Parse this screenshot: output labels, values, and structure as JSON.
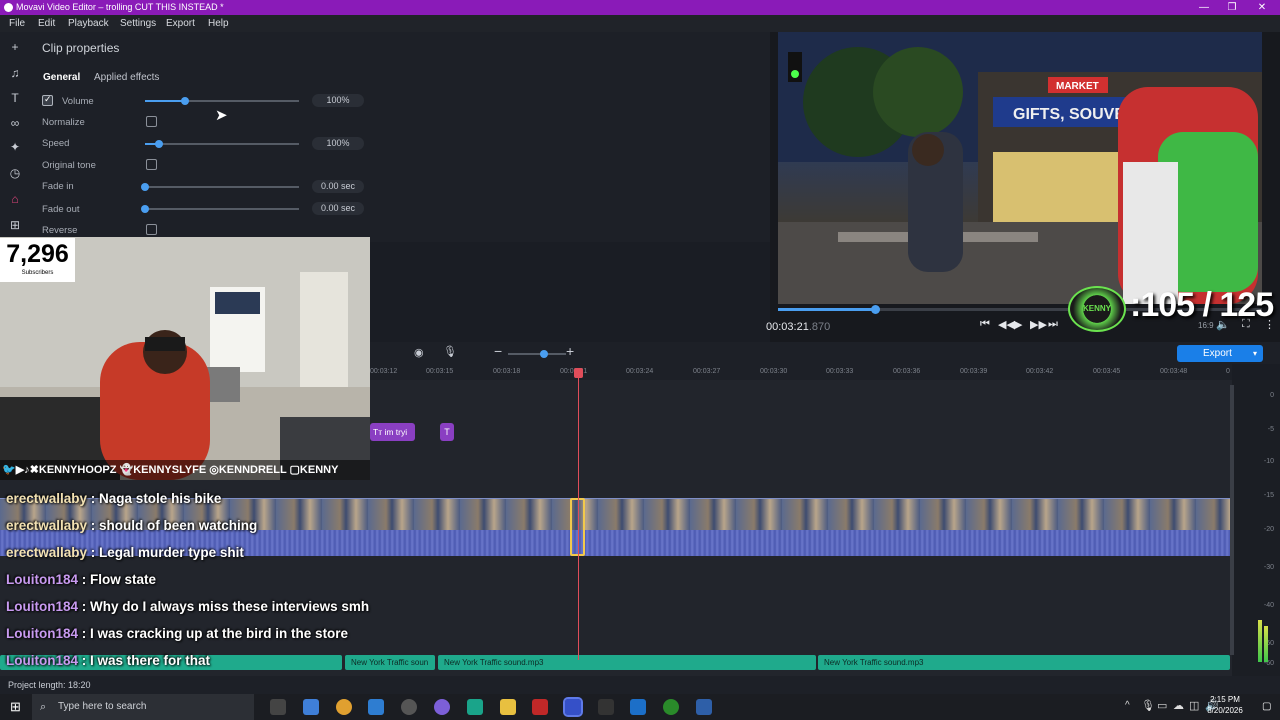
{
  "window": {
    "title": "Movavi Video Editor – trolling CUT THIS INSTEAD *",
    "controls": [
      "—",
      "❐",
      "✕"
    ]
  },
  "menu": [
    "File",
    "Edit",
    "Playback",
    "Settings",
    "Export",
    "Help"
  ],
  "sidebar_icons": [
    "plus-icon",
    "music-icon",
    "text-icon",
    "transitions-icon",
    "magic-icon",
    "clock-icon",
    "stickers-icon",
    "grid-icon"
  ],
  "props": {
    "title": "Clip properties",
    "tabs": [
      "General",
      "Applied effects"
    ],
    "rows": {
      "volume": {
        "label": "Volume",
        "value": "100%",
        "level": 0.26
      },
      "normalize": {
        "label": "Normalize"
      },
      "speed": {
        "label": "Speed",
        "value": "100%",
        "level": 0.09
      },
      "original_tone": {
        "label": "Original tone"
      },
      "fade_in": {
        "label": "Fade in",
        "value": "0.00 sec",
        "level": 0
      },
      "fade_out": {
        "label": "Fade out",
        "value": "0.00 sec",
        "level": 0
      },
      "reverse": {
        "label": "Reverse"
      }
    }
  },
  "player": {
    "timecode_main": "00:03:21",
    "timecode_frac": ".870",
    "aspect": "16:9",
    "progress": 0.2
  },
  "overlay": {
    "subs_count": "7,296",
    "subs_label": "Subscribers",
    "socials": "🐦▶♪✖KENNYHOOPZ 👻KENNYSLYFE ◎KENNDRELL ▢KENNY",
    "counter": ":105 / 125",
    "badge": "KENNY"
  },
  "chat": [
    {
      "user": "erectwallaby",
      "msg": " : Naga stole his bike"
    },
    {
      "user": "erectwallaby",
      "msg": " : should of been watching"
    },
    {
      "user": "erectwallaby",
      "msg": " : Legal murder type shit"
    },
    {
      "user": "Louiton184",
      "msg": " : Flow state"
    },
    {
      "user": "Louiton184",
      "msg": " : Why do I always miss these interviews smh"
    },
    {
      "user": "Louiton184",
      "msg": " : I was cracking up at the bird in the store"
    },
    {
      "user": "Louiton184",
      "msg": " : I was there for that"
    }
  ],
  "timeline": {
    "export_label": "Export",
    "ruler": [
      "00:03:12",
      "00:03:15",
      "00:03:18",
      "00:03:21",
      "00:03:24",
      "00:03:27",
      "00:03:30",
      "00:03:33",
      "00:03:36",
      "00:03:39",
      "00:03:42",
      "00:03:45",
      "00:03:48",
      "0"
    ],
    "title_clip": "Tт im tryi",
    "title_clip2": "T",
    "audio_clips": [
      "New York Traffic soun",
      "New York Traffic sound.mp3",
      "New York Traffic sound.mp3"
    ],
    "meter_scale": [
      "0",
      "-5",
      "-10",
      "-15",
      "-20",
      "-30",
      "-40",
      "-50",
      "-60"
    ]
  },
  "status": {
    "project_length": "Project length: 18:20"
  },
  "taskbar": {
    "search_placeholder": "Type here to search",
    "time": "2:15 PM",
    "date": "8/20/2026"
  }
}
